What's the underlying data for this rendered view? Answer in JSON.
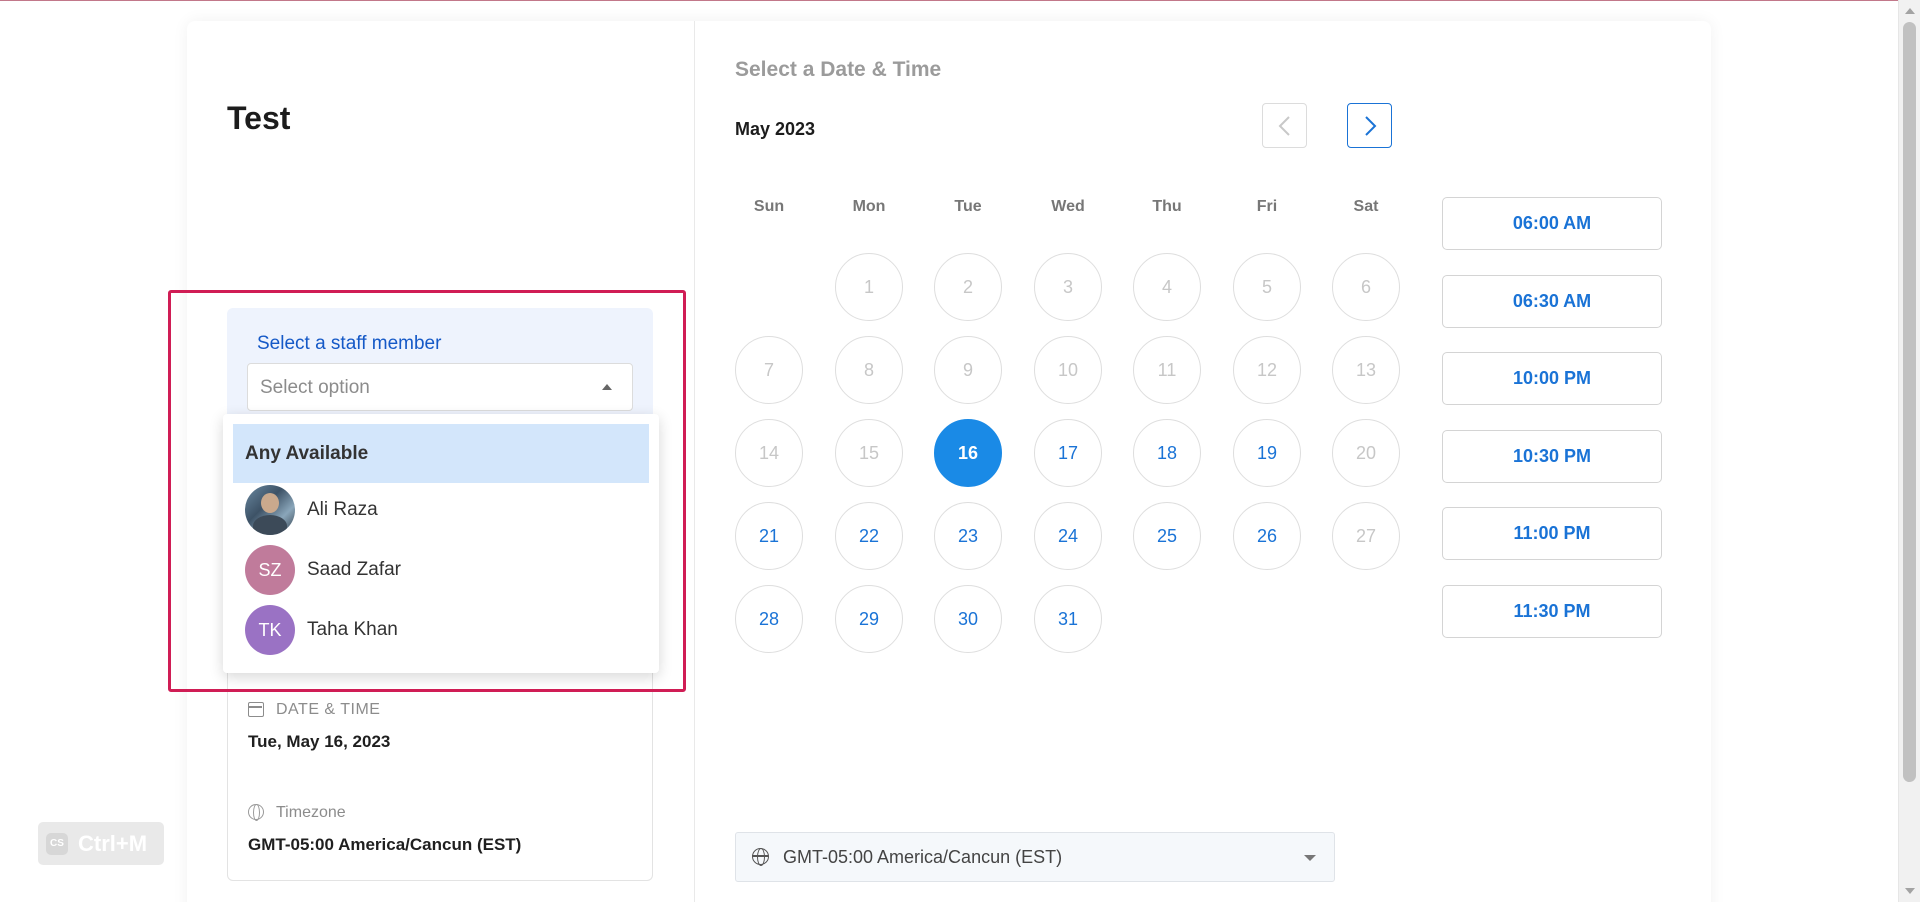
{
  "event": {
    "title": "Test"
  },
  "staff": {
    "label": "Select a staff member",
    "placeholder": "Select option",
    "options": [
      {
        "label": "Any Available",
        "highlighted": true
      },
      {
        "label": "Ali Raza",
        "avatar": "photo"
      },
      {
        "label": "Saad Zafar",
        "initials": "SZ"
      },
      {
        "label": "Taha Khan",
        "initials": "TK"
      }
    ]
  },
  "summary": {
    "date_label": "DATE & TIME",
    "date_value": "Tue, May 16, 2023",
    "timezone_label": "Timezone",
    "timezone_value": "GMT-05:00 America/Cancun (EST)"
  },
  "badge": {
    "logo": "CS",
    "text": "Ctrl+M"
  },
  "calendar": {
    "heading": "Select a Date & Time",
    "month": "May 2023",
    "weekdays": [
      "Sun",
      "Mon",
      "Tue",
      "Wed",
      "Thu",
      "Fri",
      "Sat"
    ],
    "first_weekday_index": 1,
    "days_in_month": 31,
    "available_days": [
      17,
      18,
      19,
      21,
      22,
      23,
      24,
      25,
      26,
      28,
      29,
      30,
      31
    ],
    "selected_day": 16
  },
  "time_slots": [
    "06:00 AM",
    "06:30 AM",
    "10:00 PM",
    "10:30 PM",
    "11:00 PM",
    "11:30 PM"
  ],
  "timezone_select": {
    "value": "GMT-05:00 America/Cancun (EST)"
  },
  "colors": {
    "accent": "#1a73d6",
    "selected": "#1a8ae6",
    "highlight_border": "#d01d55"
  }
}
